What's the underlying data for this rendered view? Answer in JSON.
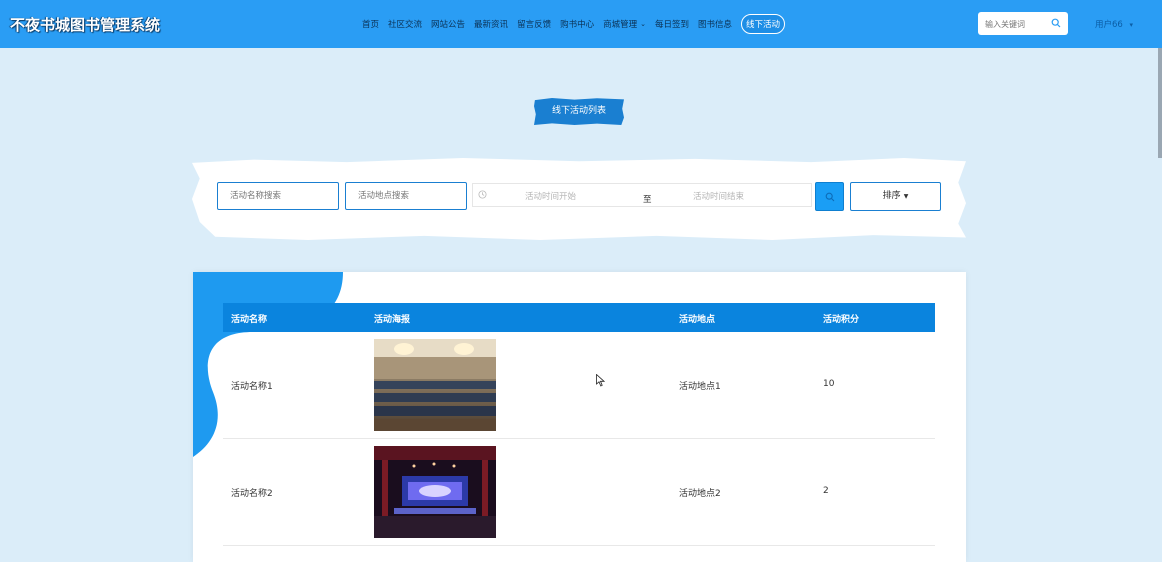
{
  "header": {
    "logo": "不夜书城图书管理系统",
    "nav": [
      {
        "label": "首页"
      },
      {
        "label": "社区交流"
      },
      {
        "label": "网站公告"
      },
      {
        "label": "最新资讯"
      },
      {
        "label": "留言反馈"
      },
      {
        "label": "购书中心"
      },
      {
        "label": "商城管理"
      },
      {
        "label": "每日签到"
      },
      {
        "label": "图书信息"
      },
      {
        "label": "线下活动"
      }
    ],
    "search_placeholder": "输入关键词",
    "user": "用户66"
  },
  "page_title": "线下活动列表",
  "filters": {
    "name_placeholder": "活动名称搜索",
    "place_placeholder": "活动地点搜索",
    "time_start": "活动时间开始",
    "time_sep": "至",
    "time_end": "活动时间结束",
    "sort_label": "排序"
  },
  "table": {
    "columns": [
      "活动名称",
      "活动海报",
      "活动地点",
      "活动积分"
    ],
    "rows": [
      {
        "name": "活动名称1",
        "place": "活动地点1",
        "points": "10"
      },
      {
        "name": "活动名称2",
        "place": "活动地点2",
        "points": "2"
      }
    ]
  },
  "colors": {
    "header_bg": "#2a9df4",
    "page_bg": "#dbedf9",
    "accent": "#0a84de"
  }
}
